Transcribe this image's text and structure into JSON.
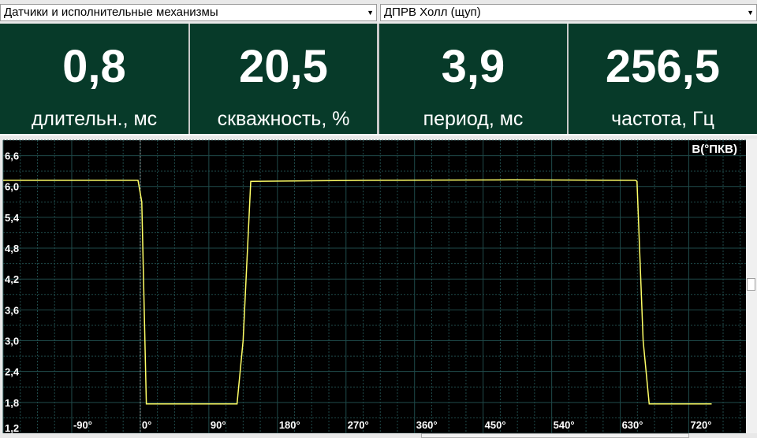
{
  "toolbar": {
    "sensor_group": "Датчики и исполнительные механизмы",
    "sensor": "ДПРВ Холл (щуп)"
  },
  "metrics": [
    {
      "value": "0,8",
      "label": "длительн., мс"
    },
    {
      "value": "20,5",
      "label": "скважность, %"
    },
    {
      "value": "3,9",
      "label": "период, мс"
    },
    {
      "value": "256,5",
      "label": "частота, Гц"
    }
  ],
  "colors": {
    "panel_bg": "#073a29",
    "plot_bg": "#000000",
    "grid": "#1f4a4a",
    "trace": "#ffff66",
    "text": "#ffffff"
  },
  "chart_data": {
    "type": "line",
    "title": "В(°ПКВ)",
    "y_ticks": [
      "6,6",
      "6,0",
      "5,4",
      "4,8",
      "4,2",
      "3,6",
      "3,0",
      "2,4",
      "1,8",
      "1,2"
    ],
    "x_ticks": [
      "-90°",
      "0°",
      "90°",
      "180°",
      "270°",
      "360°",
      "450°",
      "540°",
      "630°",
      "720°"
    ],
    "xlim": [
      -180,
      795
    ],
    "ylim": [
      1.2,
      6.9
    ],
    "grid": true,
    "series": [
      {
        "values": [
          [
            -180,
            6.12
          ],
          [
            -3,
            6.12
          ],
          [
            2,
            5.7
          ],
          [
            8,
            1.77
          ],
          [
            127,
            1.77
          ],
          [
            135,
            3.0
          ],
          [
            145,
            6.1
          ],
          [
            300,
            6.12
          ],
          [
            487,
            6.13
          ],
          [
            650,
            6.12
          ],
          [
            652,
            6.1
          ],
          [
            660,
            3.0
          ],
          [
            668,
            1.77
          ],
          [
            750,
            1.77
          ]
        ]
      }
    ]
  }
}
